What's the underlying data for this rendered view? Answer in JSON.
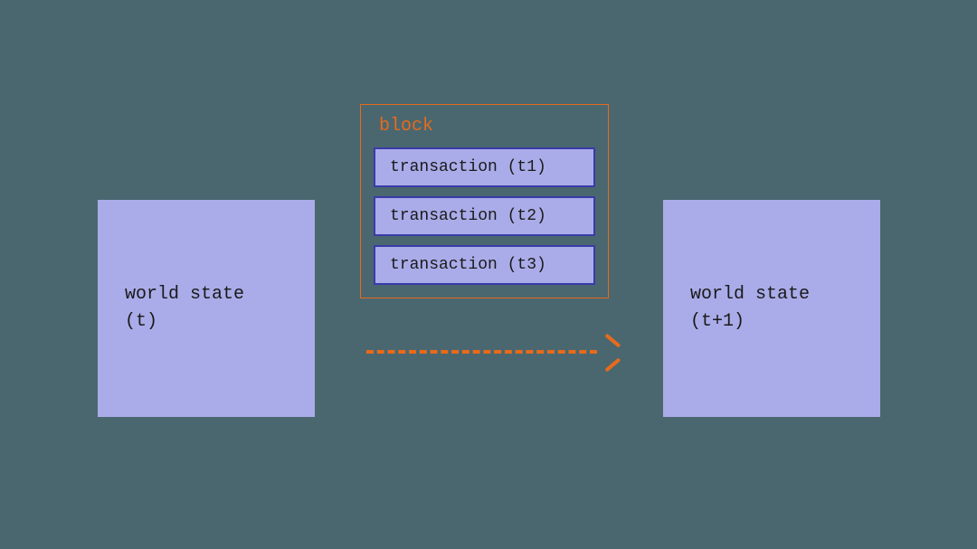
{
  "diagram": {
    "state_before": {
      "line1": "world state",
      "line2": "(t)"
    },
    "state_after": {
      "line1": "world state",
      "line2": "(t+1)"
    },
    "block": {
      "title": "block",
      "transactions": [
        "transaction (t1)",
        "transaction (t2)",
        "transaction (t3)"
      ]
    }
  },
  "colors": {
    "background": "#4a6770",
    "box_fill": "#aaace9",
    "box_border": "#3a3aa8",
    "accent": "#e86a1a"
  }
}
